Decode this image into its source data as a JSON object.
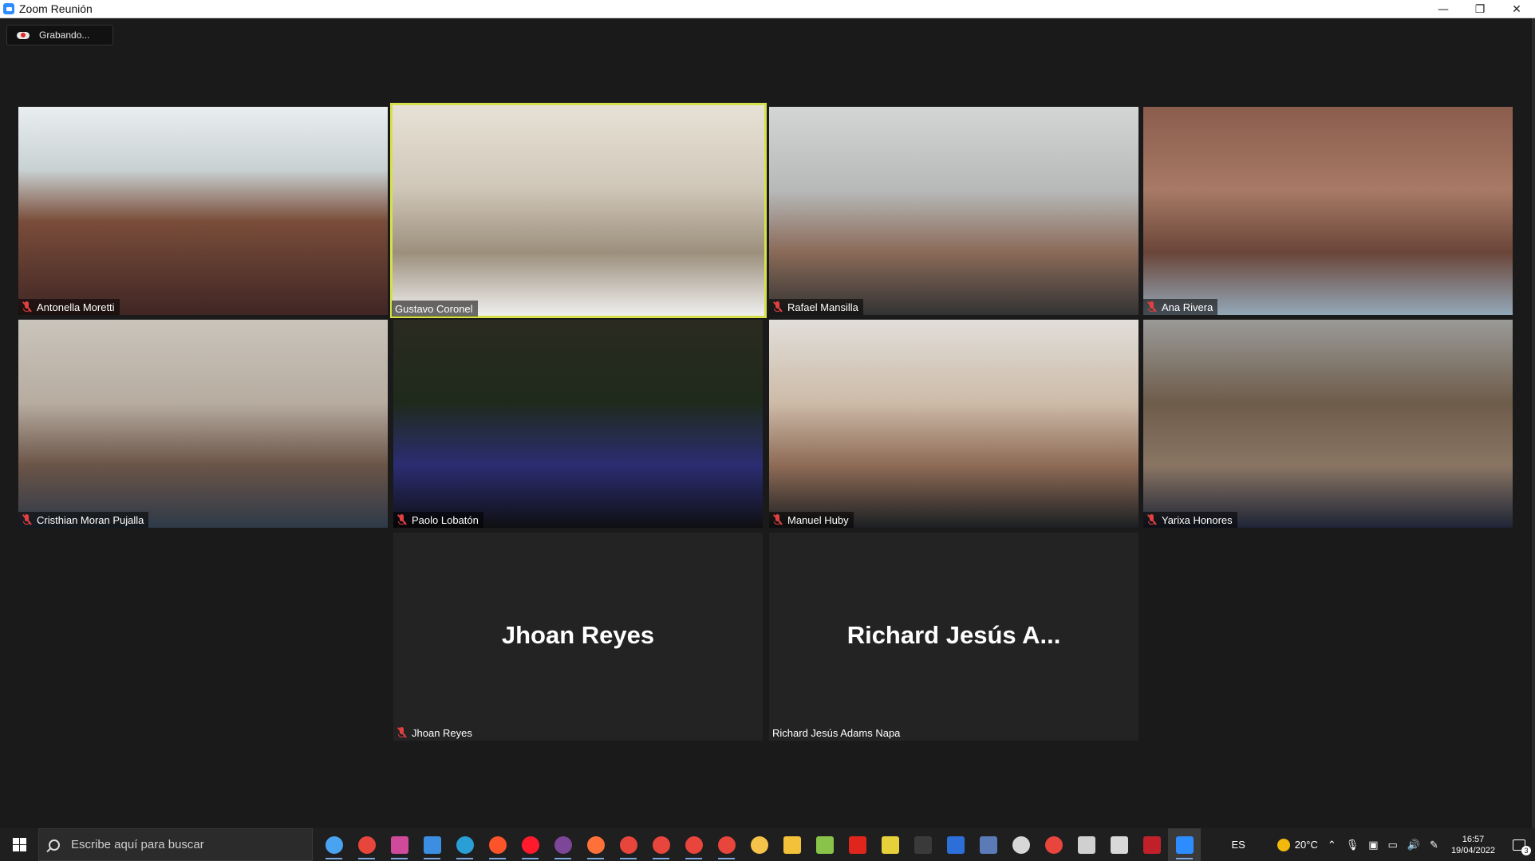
{
  "window": {
    "title": "Zoom Reunión",
    "minimize": "—",
    "restore": "❐",
    "close": "✕"
  },
  "recording": {
    "label": "Grabando..."
  },
  "participants": [
    {
      "name": "Antonella Moretti",
      "muted": true,
      "video": true,
      "bg": "linear-gradient(180deg,#e9eef0 0%,#c9d2d3 30%,#7a4d3a 55%,#402624 100%)"
    },
    {
      "name": "Gustavo Coronel",
      "muted": false,
      "video": true,
      "active": true,
      "bg": "linear-gradient(180deg,#e8e2d6 0%,#cfc6b8 40%,#9c8f7c 70%,#f1f1f1 100%)"
    },
    {
      "name": "Rafael Mansilla",
      "muted": true,
      "video": true,
      "bg": "linear-gradient(180deg,#d4d6d6 0%,#b7b9b9 40%,#8a6a58 70%,#333 100%)"
    },
    {
      "name": "Ana Rivera",
      "muted": true,
      "video": true,
      "bg": "linear-gradient(180deg,#8a5d4d 0%,#a77a66 40%,#6a4538 70%,#93a8b8 100%)"
    },
    {
      "name": "Cristhian Moran Pujalla",
      "muted": true,
      "video": true,
      "bg": "linear-gradient(180deg,#c9c4bb 0%,#b7aca0 40%,#6b5448 70%,#2e3a48 100%)"
    },
    {
      "name": "Paolo Lobatón",
      "muted": true,
      "video": true,
      "bg": "linear-gradient(180deg,#2a2a20 0%,#1f2a1c 40%,#2b2d72 70%,#0f0f12 100%)"
    },
    {
      "name": "Manuel Huby",
      "muted": true,
      "video": true,
      "bg": "linear-gradient(180deg,#e1ded9 0%,#cdbba8 40%,#8e6b56 70%,#1c1f22 100%)"
    },
    {
      "name": "Yarixa Honores",
      "muted": true,
      "video": true,
      "bg": "linear-gradient(180deg,#9a9a98 0%,#6e5c4a 40%,#8a7563 70%,#1e2436 100%)"
    },
    {
      "name": "Jhoan Reyes",
      "muted": true,
      "video": false,
      "display_name": "Jhoan Reyes"
    },
    {
      "name": "Richard Jesús Adams Napa",
      "muted": false,
      "video": false,
      "display_name": "Richard Jesús A..."
    }
  ],
  "taskbar": {
    "search_placeholder": "Escribe aquí para buscar",
    "apps": [
      {
        "icon": "cortana-icon",
        "color": "#4aa3f0"
      },
      {
        "icon": "chrome-icon",
        "color": "#e8453c"
      },
      {
        "icon": "chrome-profile-icon",
        "color": "#d04a9c"
      },
      {
        "icon": "mail-icon",
        "color": "#3b8ee0"
      },
      {
        "icon": "edge-icon",
        "color": "#2a9fd6"
      },
      {
        "icon": "brave-icon",
        "color": "#fb542b"
      },
      {
        "icon": "opera-icon",
        "color": "#ff1b2d"
      },
      {
        "icon": "tor-icon",
        "color": "#7d4698"
      },
      {
        "icon": "firefox-icon",
        "color": "#ff7139"
      },
      {
        "icon": "chrome-icon-2",
        "color": "#e8453c"
      },
      {
        "icon": "chrome-icon-3",
        "color": "#e8453c"
      },
      {
        "icon": "chrome-icon-4",
        "color": "#e8453c"
      },
      {
        "icon": "chrome-icon-5",
        "color": "#e8453c"
      },
      {
        "icon": "paint-icon",
        "color": "#f6c34a"
      },
      {
        "icon": "file-explorer-icon",
        "color": "#f3c13a"
      },
      {
        "icon": "notepad-icon",
        "color": "#8ac34a"
      },
      {
        "icon": "acrobat-icon",
        "color": "#e0261c"
      },
      {
        "icon": "sticky-tool-icon",
        "color": "#e6d13a"
      },
      {
        "icon": "terminal-icon",
        "color": "#3a3a3a"
      },
      {
        "icon": "vscode-dev-icon",
        "color": "#2d6fd8"
      },
      {
        "icon": "calculator-icon",
        "color": "#5b7ab8"
      },
      {
        "icon": "cloud-app-icon",
        "color": "#d7d7d7"
      },
      {
        "icon": "anydesk-icon",
        "color": "#e8453c"
      },
      {
        "icon": "settings-icon",
        "color": "#d0d0d0"
      },
      {
        "icon": "window-app-icon",
        "color": "#d8d8d8"
      },
      {
        "icon": "pdf-viewer-icon",
        "color": "#c0202a"
      },
      {
        "icon": "zoom-icon",
        "color": "#2d8cff"
      }
    ],
    "language": "ES",
    "weather": "20°C",
    "time": "16:57",
    "date": "19/04/2022",
    "notifications": "3"
  }
}
